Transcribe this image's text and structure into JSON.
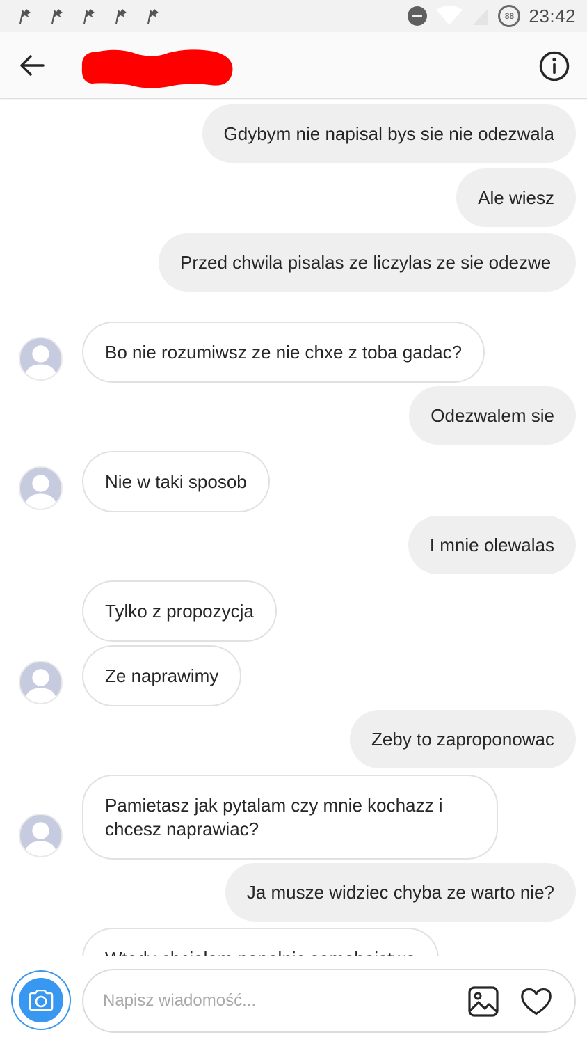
{
  "status_bar": {
    "time": "23:42",
    "battery_level": "88",
    "notification_icons": [
      "flag-icon",
      "flag-icon",
      "flag-icon",
      "flag-icon",
      "flag-icon"
    ],
    "status_icons": [
      "do-not-disturb-icon",
      "wifi-icon",
      "cell-signal-icon",
      "battery-icon"
    ]
  },
  "header": {
    "back_icon": "arrow-left-icon",
    "contact_name_redacted": true,
    "info_icon": "info-icon"
  },
  "messages": [
    {
      "direction": "outgoing",
      "text": "Gdybym nie napisal bys sie nie odezwala"
    },
    {
      "direction": "outgoing",
      "text": "Ale wiesz"
    },
    {
      "direction": "outgoing",
      "text": "Przed chwila pisalas ze liczylas ze sie odezwe"
    },
    {
      "direction": "incoming",
      "text": "Bo nie rozumiwsz ze nie chxe z toba gadac?",
      "avatar": true
    },
    {
      "direction": "outgoing",
      "text": "Odezwalem sie"
    },
    {
      "direction": "incoming",
      "text": "Nie w taki sposob",
      "avatar": true
    },
    {
      "direction": "outgoing",
      "text": "I mnie olewalas"
    },
    {
      "direction": "incoming",
      "text": "Tylko z propozycja",
      "avatar": false
    },
    {
      "direction": "incoming",
      "text": "Ze naprawimy",
      "avatar": true
    },
    {
      "direction": "outgoing",
      "text": "Zeby to zaproponowac"
    },
    {
      "direction": "incoming",
      "text": "Pamietasz jak pytalam czy mnie kochazz i chcesz naprawiac?",
      "avatar": true
    },
    {
      "direction": "outgoing",
      "text": "Ja musze widziec chyba ze warto nie?"
    },
    {
      "direction": "incoming",
      "text": "Wtedy chcialam popelnic samobojstwo",
      "avatar": false,
      "partially_visible": true
    }
  ],
  "composer": {
    "placeholder": "Napisz wiadomość...",
    "camera_icon": "camera-icon",
    "gallery_icon": "gallery-icon",
    "like_icon": "heart-icon",
    "accent_color": "#3897f0"
  },
  "colors": {
    "outgoing_bubble": "#efefef",
    "incoming_bubble_border": "#e1e1e1",
    "redaction": "#ff0000"
  }
}
